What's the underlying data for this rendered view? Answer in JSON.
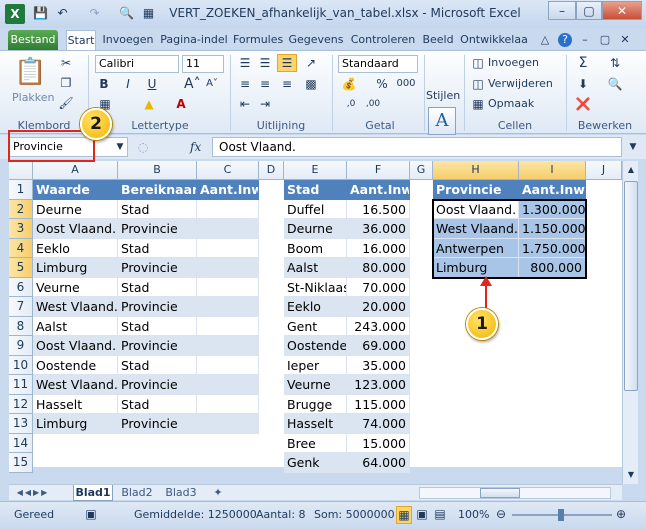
{
  "window": {
    "title": "VERT_ZOEKEN_afhankelijk_van_tabel.xlsx - Microsoft Excel",
    "app_logo": "X",
    "controls": [
      "–",
      "▢",
      "✕"
    ]
  },
  "qat": [
    "save-icon",
    "undo-icon",
    "redo-icon",
    "print-preview-icon",
    "customize-icon"
  ],
  "tabs": [
    "Bestand",
    "Start",
    "Invoegen",
    "Pagina-indel",
    "Formules",
    "Gegevens",
    "Controleren",
    "Beeld",
    "Ontwikkelaa"
  ],
  "ribbon": {
    "clipboard": {
      "paste_label": "Plakken",
      "group": "Klembord"
    },
    "font": {
      "name": "Calibri",
      "size": "11",
      "group": "Lettertype",
      "bold": "B",
      "italic": "I",
      "underline": "U"
    },
    "alignment": {
      "group": "Uitlijning"
    },
    "number": {
      "format": "Standaard",
      "group": "Getal",
      "percent": "%",
      "thousands": "000"
    },
    "styles": {
      "label": "Stijlen"
    },
    "cells": {
      "insert": "Invoegen",
      "delete": "Verwijderen",
      "format": "Opmaak",
      "group": "Cellen"
    },
    "editing": {
      "group": "Bewerken",
      "sum": "Σ"
    }
  },
  "formula_bar": {
    "name_box": "Provincie",
    "fx": "fx",
    "content": "Oost Vlaand."
  },
  "columns": [
    "A",
    "B",
    "C",
    "D",
    "E",
    "F",
    "G",
    "H",
    "I",
    "J"
  ],
  "rows": [
    "1",
    "2",
    "3",
    "4",
    "5",
    "6",
    "7",
    "8",
    "9",
    "10",
    "11",
    "12",
    "13",
    "14",
    "15"
  ],
  "table1": {
    "headers": [
      "Waarde",
      "Bereiknaam",
      "Aant.Inw."
    ],
    "rows": [
      [
        "Deurne",
        "Stad",
        ""
      ],
      [
        "Oost Vlaand.",
        "Provincie",
        ""
      ],
      [
        "Eeklo",
        "Stad",
        ""
      ],
      [
        "Limburg",
        "Provincie",
        ""
      ],
      [
        "Veurne",
        "Stad",
        ""
      ],
      [
        "West Vlaand.",
        "Provincie",
        ""
      ],
      [
        "Aalst",
        "Stad",
        ""
      ],
      [
        "Oost Vlaand.",
        "Provincie",
        ""
      ],
      [
        "Oostende",
        "Stad",
        ""
      ],
      [
        "West Vlaand.",
        "Provincie",
        ""
      ],
      [
        "Hasselt",
        "Stad",
        ""
      ],
      [
        "Limburg",
        "Provincie",
        ""
      ]
    ]
  },
  "table2": {
    "headers": [
      "Stad",
      "Aant.Inw."
    ],
    "rows": [
      [
        "Duffel",
        "16.500"
      ],
      [
        "Deurne",
        "36.000"
      ],
      [
        "Boom",
        "16.000"
      ],
      [
        "Aalst",
        "80.000"
      ],
      [
        "St-Niklaas",
        "70.000"
      ],
      [
        "Eeklo",
        "20.000"
      ],
      [
        "Gent",
        "243.000"
      ],
      [
        "Oostende",
        "69.000"
      ],
      [
        "Ieper",
        "35.000"
      ],
      [
        "Veurne",
        "123.000"
      ],
      [
        "Brugge",
        "115.000"
      ],
      [
        "Hasselt",
        "74.000"
      ],
      [
        "Bree",
        "15.000"
      ],
      [
        "Genk",
        "64.000"
      ]
    ]
  },
  "table3": {
    "headers": [
      "Provincie",
      "Aant.Inw."
    ],
    "rows": [
      [
        "Oost Vlaand.",
        "1.300.000"
      ],
      [
        "West Vlaand.",
        "1.150.000"
      ],
      [
        "Antwerpen",
        "1.750.000"
      ],
      [
        "Limburg",
        "800.000"
      ]
    ]
  },
  "sheets": [
    "Blad1",
    "Blad2",
    "Blad3"
  ],
  "status": {
    "ready": "Gereed",
    "average": "Gemiddelde: 1250000",
    "count": "Aantal: 8",
    "sum": "Som: 5000000",
    "zoom": "100%"
  },
  "callouts": [
    "1",
    "2"
  ],
  "colors": {
    "table_header": "#4f81bd",
    "band": "#dbe5f1",
    "highlight": "#a8c4e6",
    "callout": "#f5b400",
    "callout_box": "#e0261d"
  }
}
